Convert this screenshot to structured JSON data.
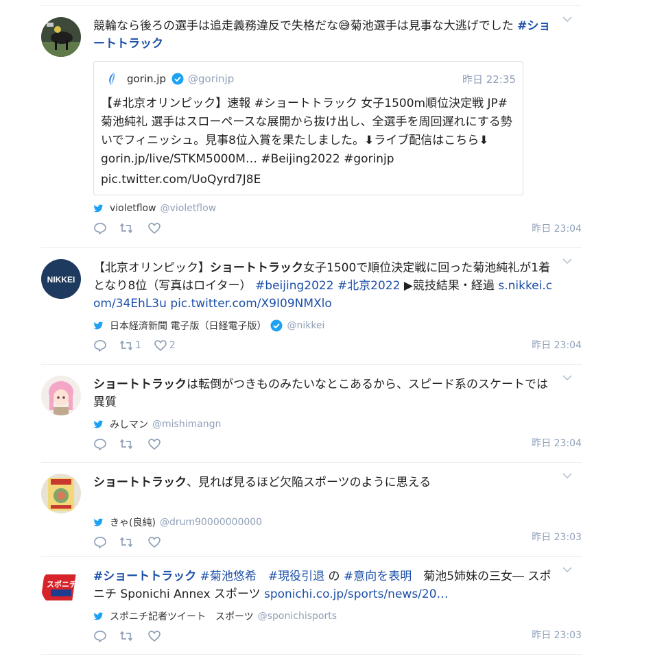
{
  "tweets": [
    {
      "text_parts": [
        {
          "t": "競輪なら後ろの選手は追走義務違反で失格だな😅菊池選手は見事な大逃げでした ",
          "style": "plain"
        },
        {
          "t": "#ショートトラック",
          "style": "link-bold"
        }
      ],
      "quote": {
        "name": "gorin.jp",
        "handle": "@gorinjp",
        "time": "昨日 22:35",
        "text": "【#北京オリンピック】速報 #ショートトラック 女子1500m順位決定戦 JP#菊池純礼 選手はスローペースな展開から抜け出し、全選手を周回遅れにする勢いでフィニッシュ。見事8位入賞を果たしました。⬇ライブ配信はこちら⬇ gorin.jp/live/STKM5000M… #Beijing2022 #gorinjp",
        "pic": "pic.twitter.com/UoQyrd7J8E"
      },
      "via_name": "violetflow",
      "via_handle": "@violetflow",
      "retweets": "",
      "likes": "",
      "time": "昨日 23:04"
    },
    {
      "text_parts": [
        {
          "t": "【北京オリンピック】",
          "style": "plain"
        },
        {
          "t": "ショートトラック",
          "style": "bold"
        },
        {
          "t": "女子1500で順位決定戦に回った菊池純礼が1着となり8位（写真はロイター） ",
          "style": "plain"
        },
        {
          "t": "#beijing2022",
          "style": "link"
        },
        {
          "t": " ",
          "style": "plain"
        },
        {
          "t": "#北京2022",
          "style": "link"
        },
        {
          "t": " ▶競技結果・経過 ",
          "style": "plain"
        },
        {
          "t": "s.nikkei.com/34EhL3u",
          "style": "link"
        },
        {
          "t": " ",
          "style": "plain"
        },
        {
          "t": "pic.twitter.com/X9I09NMXlo",
          "style": "link"
        }
      ],
      "avatar_text": "NIKKEI",
      "via_name": "日本経済新聞 電子版（日経電子版）",
      "via_handle": "@nikkei",
      "retweets": "1",
      "likes": "2",
      "time": "昨日 23:04"
    },
    {
      "text_parts": [
        {
          "t": "ショートトラック",
          "style": "bold"
        },
        {
          "t": "は転倒がつきものみたいなとこあるから、スピード系のスケートでは異質",
          "style": "plain"
        }
      ],
      "via_name": "みしマン",
      "via_handle": "@mishimangn",
      "retweets": "",
      "likes": "",
      "time": "昨日 23:04"
    },
    {
      "text_parts": [
        {
          "t": "ショートトラック",
          "style": "bold"
        },
        {
          "t": "、見れば見るほど欠陥スポーツのように思える",
          "style": "plain"
        }
      ],
      "via_name": "きゃ(良純)",
      "via_handle": "@drum90000000000",
      "retweets": "",
      "likes": "",
      "time": "昨日 23:03"
    },
    {
      "text_parts": [
        {
          "t": "#ショートトラック",
          "style": "link-bold"
        },
        {
          "t": " ",
          "style": "plain"
        },
        {
          "t": "#菊池悠希",
          "style": "link"
        },
        {
          "t": "　",
          "style": "plain"
        },
        {
          "t": "#現役引退",
          "style": "link"
        },
        {
          "t": " の ",
          "style": "plain"
        },
        {
          "t": "#意向を表明",
          "style": "link"
        },
        {
          "t": "　菊池5姉妹の三女― スポニチ Sponichi Annex スポーツ ",
          "style": "plain"
        },
        {
          "t": "sponichi.co.jp/sports/news/20…",
          "style": "link"
        }
      ],
      "avatar_text": "スポニチ",
      "via_name": "スポニチ記者ツイート　スポーツ",
      "via_handle": "@sponichisports",
      "retweets": "",
      "likes": "",
      "time": "昨日 23:03"
    }
  ],
  "colors": {
    "link": "#1b4fa8",
    "muted": "#8fa0b8",
    "verified": "#1da1f2",
    "bird": "#1da1f2"
  }
}
